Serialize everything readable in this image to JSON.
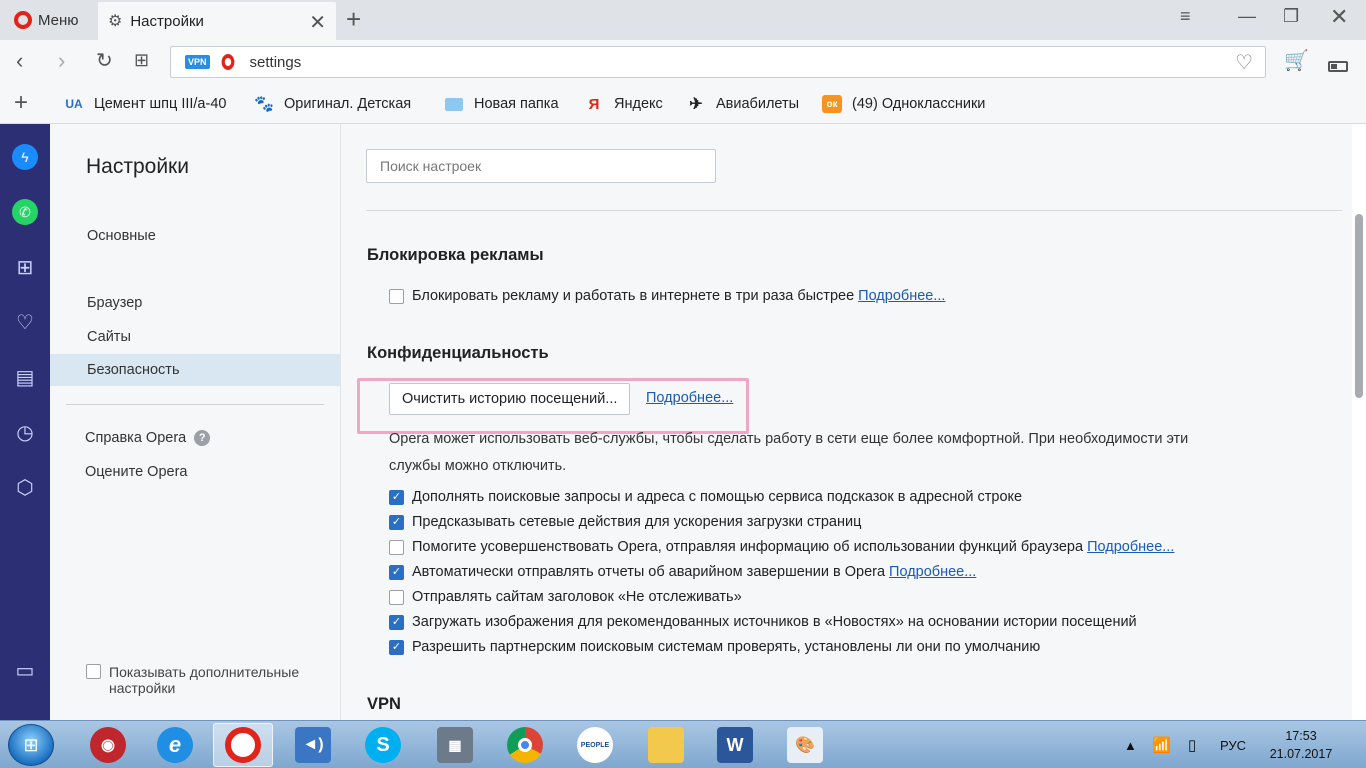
{
  "tabbar": {
    "menu_label": "Меню",
    "tab_title": "Настройки"
  },
  "address": {
    "vpn_badge": "VPN",
    "url": "settings"
  },
  "bookmarks": [
    {
      "label": "Цемент шпц III/а-40",
      "icon_text": "UA"
    },
    {
      "label": "Оригинал. Детская",
      "icon_text": ""
    },
    {
      "label": "Новая папка",
      "icon_text": ""
    },
    {
      "label": "Яндекс",
      "icon_text": "Я"
    },
    {
      "label": "Авиабилеты",
      "icon_text": "✈"
    },
    {
      "label": "(49) Одноклассники",
      "icon_text": "ок"
    }
  ],
  "settings_nav": {
    "title": "Настройки",
    "items": [
      "Основные",
      "Браузер",
      "Сайты",
      "Безопасность"
    ],
    "active_item": "Безопасность",
    "help": "Справка Opera",
    "rate": "Оцените Opera",
    "advanced": "Показывать дополнительные настройки"
  },
  "main": {
    "search_placeholder": "Поиск настроек",
    "adblock": {
      "heading": "Блокировка рекламы",
      "label": "Блокировать рекламу и работать в интернете в три раза быстрее",
      "more": "Подробнее...",
      "checked": false
    },
    "privacy": {
      "heading": "Конфиденциальность",
      "clear_button": "Очистить историю посещений...",
      "more": "Подробнее...",
      "description": "Opera может использовать веб-службы, чтобы сделать работу в сети еще более комфортной. При необходимости эти службы можно отключить.",
      "options": [
        {
          "label": "Дополнять поисковые запросы и адреса с помощью сервиса подсказок в адресной строке",
          "checked": true,
          "more": ""
        },
        {
          "label": "Предсказывать сетевые действия для ускорения загрузки страниц",
          "checked": true,
          "more": ""
        },
        {
          "label": "Помогите усовершенствовать Opera, отправляя информацию об использовании функций браузера",
          "checked": false,
          "more": "Подробнее..."
        },
        {
          "label": "Автоматически отправлять отчеты об аварийном завершении в Opera",
          "checked": true,
          "more": "Подробнее..."
        },
        {
          "label": "Отправлять сайтам заголовок «Не отслеживать»",
          "checked": false,
          "more": ""
        },
        {
          "label": "Загружать изображения для рекомендованных источников в «Новостях» на основании истории посещений",
          "checked": true,
          "more": ""
        },
        {
          "label": "Разрешить партнерским поисковым системам проверять, установлены ли они по умолчанию",
          "checked": true,
          "more": ""
        }
      ]
    },
    "vpn_heading": "VPN"
  },
  "taskbar": {
    "language": "РУС",
    "time": "17:53",
    "date": "21.07.2017"
  },
  "colors": {
    "sidebar": "#2c2f73",
    "opera_red": "#e2231a",
    "checkbox_blue": "#2b6fc4",
    "link": "#1a5bb8",
    "highlight": "#f2a6c6"
  }
}
